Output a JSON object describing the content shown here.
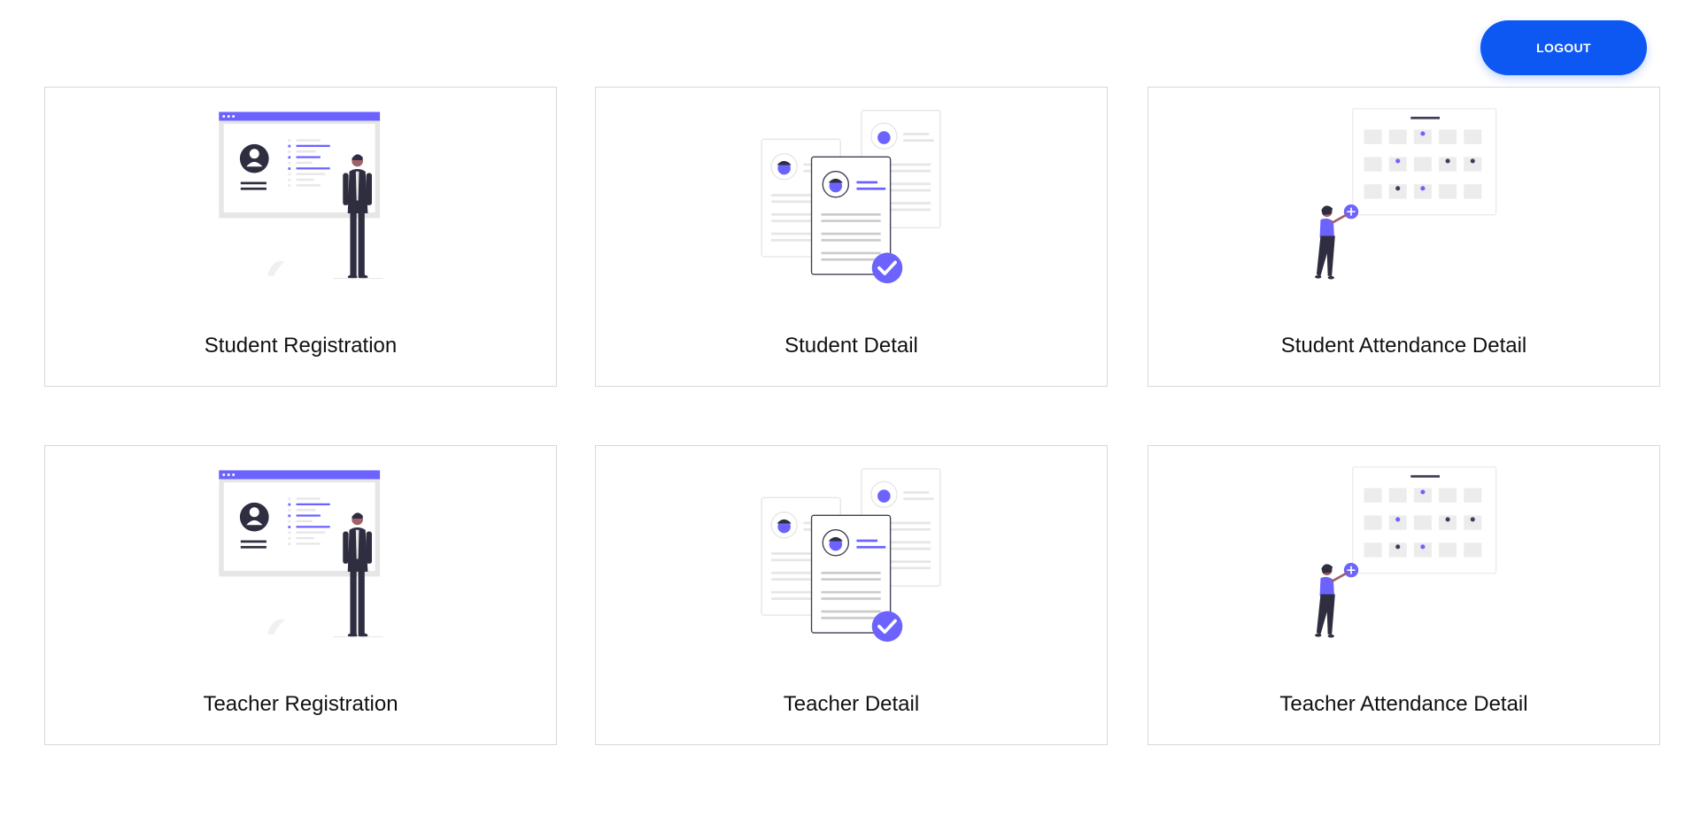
{
  "header": {
    "logout_label": "LOGOUT"
  },
  "theme": {
    "accent": "#6c63ff",
    "button": "#0d57f2",
    "dark": "#2f2e41",
    "light_gray": "#e6e6e6"
  },
  "cards": [
    {
      "label": "Student Registration",
      "illustration": "registration-board-illustration"
    },
    {
      "label": "Student Detail",
      "illustration": "profile-documents-illustration"
    },
    {
      "label": "Student Attendance Detail",
      "illustration": "attendance-calendar-illustration"
    },
    {
      "label": "Teacher Registration",
      "illustration": "registration-board-illustration"
    },
    {
      "label": "Teacher Detail",
      "illustration": "profile-documents-illustration"
    },
    {
      "label": "Teacher Attendance Detail",
      "illustration": "attendance-calendar-illustration"
    }
  ]
}
